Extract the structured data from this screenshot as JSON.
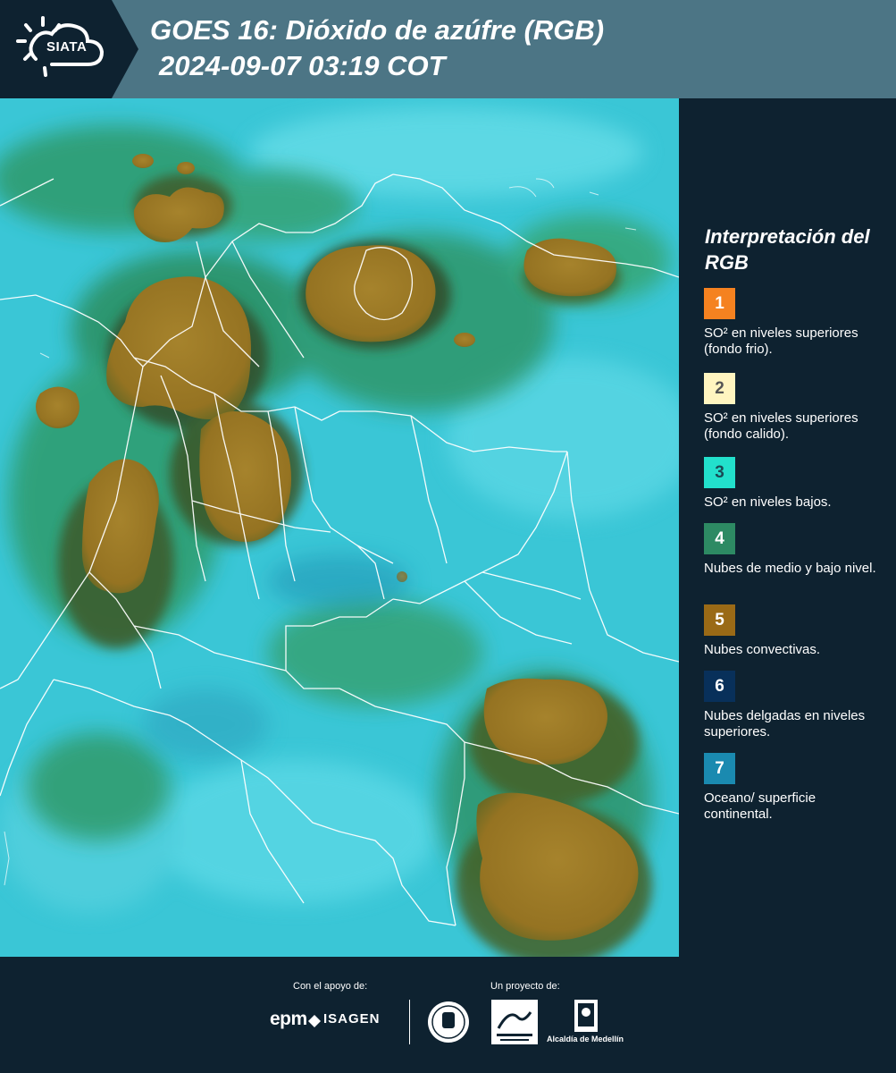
{
  "header": {
    "logo_text": "SIATA",
    "title_line1": "GOES 16: Dióxido de azúfre (RGB)",
    "title_line2": "2024-09-07 03:19 COT",
    "background": "#4c7585",
    "logo_panel": "#0e2230"
  },
  "map": {
    "icons": [
      "satellite-rgb-map"
    ],
    "colors": {
      "background": "#33c7d8",
      "convective_cloud": "#9e7d2a",
      "mid_low_cloud": "#2e9a6a",
      "borders": "#ffffff"
    }
  },
  "legend": {
    "title": "Interpretación del RGB",
    "items": [
      {
        "number": "1",
        "label": "SO² en niveles superiores (fondo frio).",
        "color": "#f58220",
        "text_color": "#ffffff"
      },
      {
        "number": "2",
        "label": "SO² en niveles superiores (fondo calido).",
        "color": "#fff5c0",
        "text_color": "#555555"
      },
      {
        "number": "3",
        "label": "SO² en niveles bajos.",
        "color": "#22e0cc",
        "text_color": "#1a4a55"
      },
      {
        "number": "4",
        "label": "Nubes de medio y bajo nivel.",
        "color": "#2d8a63",
        "text_color": "#ffffff"
      },
      {
        "number": "5",
        "label": "Nubes convectivas.",
        "color": "#9a6a16",
        "text_color": "#ffffff"
      },
      {
        "number": "6",
        "label": "Nubes delgadas en niveles superiores.",
        "color": "#08305a",
        "text_color": "#ffffff"
      },
      {
        "number": "7",
        "label": "Oceano/ superficie continental.",
        "color": "#1a8ab0",
        "text_color": "#ffffff"
      }
    ]
  },
  "footer": {
    "support_label": "Con el apoyo de:",
    "project_label": "Un proyecto de:",
    "epm": "epm",
    "isagen": "ISAGEN",
    "alcaldia": "Alcaldía de Medellín",
    "icons": [
      "epm-logo",
      "isagen-logo",
      "medellin-seal",
      "area-metropolitana-logo",
      "alcaldia-medellin-logo"
    ]
  }
}
